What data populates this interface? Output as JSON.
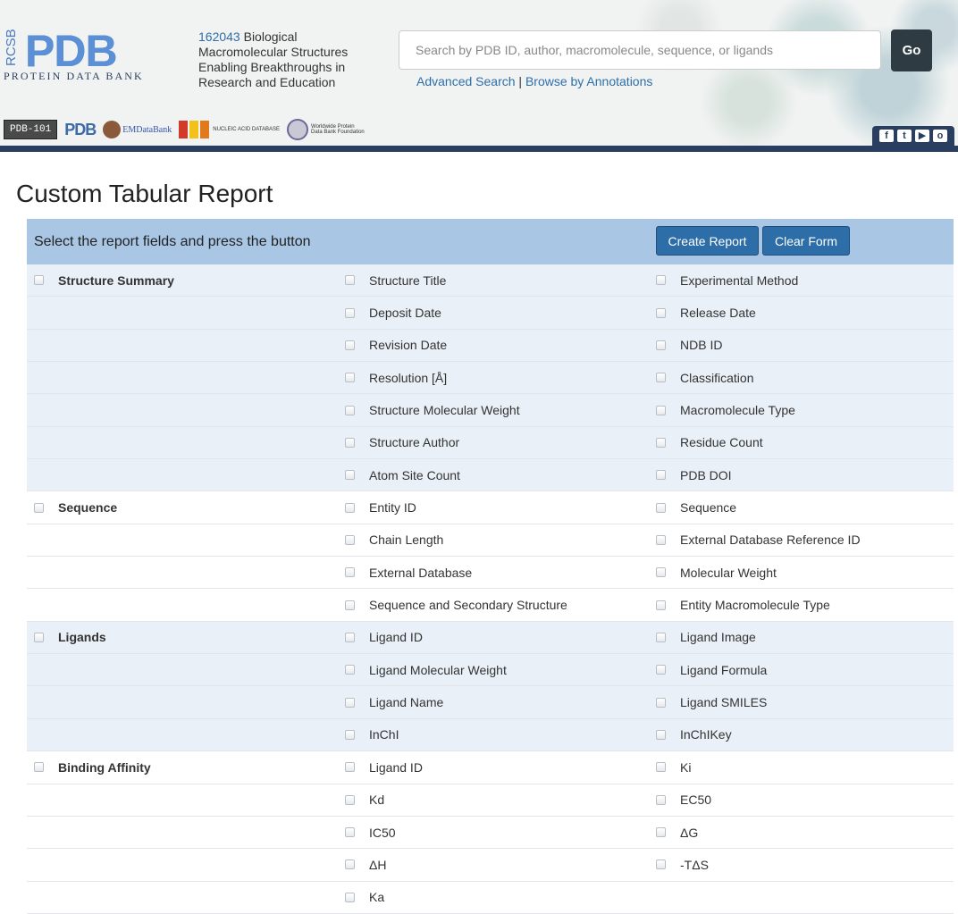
{
  "header": {
    "logo": {
      "side_text": "RCSB",
      "main_text": "PDB",
      "sub_text": "PROTEIN DATA BANK"
    },
    "tagline": {
      "count": "162043",
      "text": " Biological Macromolecular Structures Enabling Breakthroughs in Research and Education"
    },
    "search": {
      "placeholder": "Search by PDB ID, author, macromolecule, sequence, or ligands",
      "go_label": "Go"
    },
    "links": {
      "advanced": "Advanced Search",
      "separator": "|",
      "browse": "Browse by Annotations"
    },
    "partners": {
      "pdb101": "PDB-101",
      "wwpdb": "PDB",
      "emdb": "EMDataBank",
      "ndb": "NUCLEIC ACID DATABASE",
      "wwpdbf": "Worldwide Protein Data Bank Foundation"
    },
    "social": [
      "f",
      "t",
      "▶",
      "o"
    ]
  },
  "main": {
    "title": "Custom Tabular Report",
    "instruction": "Select the report fields and press the button",
    "create_label": "Create Report",
    "clear_label": "Clear Form"
  },
  "rows": [
    {
      "group": "Structure Summary",
      "a": "Structure Title",
      "b": "Experimental Method"
    },
    {
      "group": "",
      "a": "Deposit Date",
      "b": "Release Date"
    },
    {
      "group": "",
      "a": "Revision Date",
      "b": "NDB ID"
    },
    {
      "group": "",
      "a": "Resolution [Å]",
      "b": "Classification"
    },
    {
      "group": "",
      "a": "Structure Molecular Weight",
      "b": "Macromolecule Type"
    },
    {
      "group": "",
      "a": "Structure Author",
      "b": "Residue Count"
    },
    {
      "group": "",
      "a": "Atom Site Count",
      "b": "PDB DOI"
    },
    {
      "group": "Sequence",
      "a": "Entity ID",
      "b": "Sequence"
    },
    {
      "group": "",
      "a": "Chain Length",
      "b": "External Database Reference ID"
    },
    {
      "group": "",
      "a": "External Database",
      "b": "Molecular Weight"
    },
    {
      "group": "",
      "a": "Sequence and Secondary Structure",
      "b": "Entity Macromolecule Type"
    },
    {
      "group": "Ligands",
      "a": "Ligand ID",
      "b": "Ligand Image"
    },
    {
      "group": "",
      "a": "Ligand Molecular Weight",
      "b": "Ligand Formula"
    },
    {
      "group": "",
      "a": "Ligand Name",
      "b": "Ligand SMILES"
    },
    {
      "group": "",
      "a": "InChI",
      "b": "InChIKey"
    },
    {
      "group": "Binding Affinity",
      "a": "Ligand ID",
      "b": "Ki"
    },
    {
      "group": "",
      "a": "Kd",
      "b": "EC50"
    },
    {
      "group": "",
      "a": "IC50",
      "b": "ΔG"
    },
    {
      "group": "",
      "a": "ΔH",
      "b": "-TΔS"
    },
    {
      "group": "",
      "a": "Ka",
      "b": ""
    }
  ]
}
